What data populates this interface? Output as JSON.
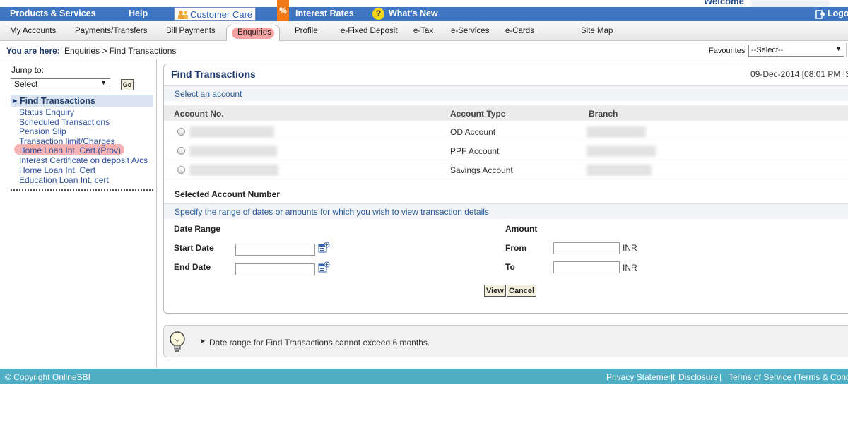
{
  "topbar": {
    "products": "Products & Services",
    "help": "Help",
    "customer_care": "Customer Care",
    "percent": "%",
    "interest_rates": "Interest Rates",
    "whats_new_icon": "?",
    "whats_new": "What's New",
    "welcome": "Welcome",
    "logout": "Logo"
  },
  "nav": {
    "items": [
      "My Accounts",
      "Payments/Transfers",
      "Bill Payments",
      "Enquiries",
      "Profile",
      "e-Fixed Deposit",
      "e-Tax",
      "e-Services",
      "e-Cards",
      "Site Map"
    ],
    "active": "Enquiries"
  },
  "breadcrumb": {
    "label": "You are here:",
    "path": "Enquiries > Find Transactions"
  },
  "favourites": {
    "label": "Favourites",
    "selected": "--Select--"
  },
  "sidebar": {
    "jump_label": "Jump to:",
    "jump_selected": "Select",
    "go": "Go",
    "active": "Find Transactions",
    "links": [
      "Status Enquiry",
      "Scheduled Transactions",
      "Pension Slip",
      "Transaction limit/Charges",
      "Home Loan Int. Cert.(Prov)",
      "Interest Certificate on deposit A/cs",
      "Home Loan Int. Cert",
      "Education Loan Int. cert"
    ]
  },
  "main": {
    "title": "Find Transactions",
    "datetime": "09-Dec-2014 [08:01 PM IS",
    "select_account": "Select an account",
    "columns": [
      "Account No.",
      "Account Type",
      "Branch"
    ],
    "accounts": [
      {
        "type": "OD Account"
      },
      {
        "type": "PPF Account"
      },
      {
        "type": "Savings Account"
      }
    ],
    "selected_account_label": "Selected Account Number",
    "range_instruction": "Specify the range of dates or amounts for which you wish to view transaction details",
    "date_range": "Date Range",
    "start_date": "Start Date",
    "end_date": "End Date",
    "amount": "Amount",
    "from": "From",
    "to": "To",
    "currency": "INR",
    "view": "View",
    "cancel": "Cancel"
  },
  "tip": {
    "text": "Date range for Find Transactions cannot exceed 6 months."
  },
  "footer": {
    "copyright": "© Copyright OnlineSBI",
    "privacy": "Privacy Statement",
    "disclosure": "Disclosure",
    "terms": "Terms of Service (Terms & Conditio",
    "separator": "|"
  },
  "colors": {
    "topbar": "#3e76c4",
    "footer": "#4faec4",
    "highlight": "#f6a3a3",
    "heading": "#1f3c6e"
  }
}
